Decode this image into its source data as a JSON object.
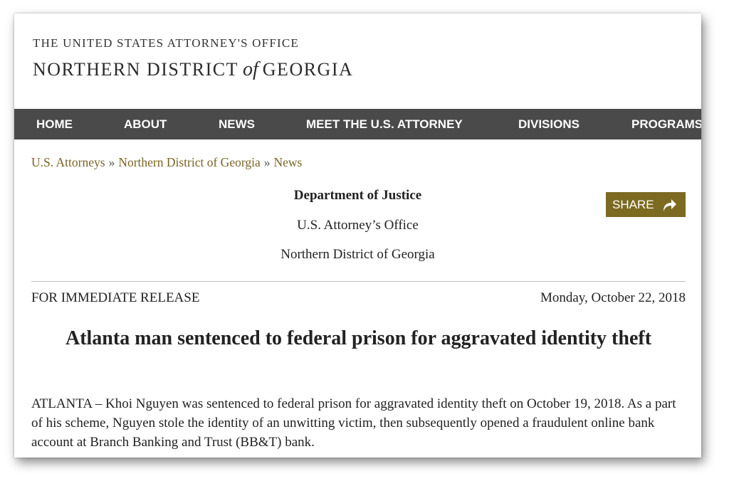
{
  "header": {
    "line1": "The United States Attorney's Office",
    "line2_part1": "NORTHERN DISTRICT",
    "line2_of": "of",
    "line2_part2": "GEORGIA"
  },
  "nav": {
    "items": [
      {
        "label": "HOME"
      },
      {
        "label": "ABOUT"
      },
      {
        "label": "NEWS"
      },
      {
        "label": "MEET THE U.S. ATTORNEY"
      },
      {
        "label": "DIVISIONS"
      },
      {
        "label": "PROGRAMS"
      }
    ]
  },
  "breadcrumb": {
    "items": [
      "U.S. Attorneys",
      "Northern District of Georgia",
      "News"
    ],
    "separator": "»"
  },
  "dept": {
    "title": "Department of Justice",
    "office": "U.S. Attorney’s Office",
    "district": "Northern District of Georgia"
  },
  "share": {
    "label": "SHARE",
    "icon": "share-arrow-icon",
    "color": "#7c6a20"
  },
  "release": {
    "label": "FOR IMMEDIATE RELEASE",
    "date": "Monday, October 22, 2018"
  },
  "article": {
    "headline": "Atlanta man sentenced to federal prison for aggravated identity theft",
    "body": "ATLANTA – Khoi Nguyen was sentenced to federal prison for aggravated identity theft on October 19, 2018.  As a part of his scheme, Nguyen stole the identity of an unwitting victim, then subsequently opened a fraudulent online bank account at Branch Banking and Trust (BB&T) bank."
  },
  "colors": {
    "nav_bg": "#4a4a4a",
    "link": "#7a6426",
    "accent": "#7c6a20"
  }
}
